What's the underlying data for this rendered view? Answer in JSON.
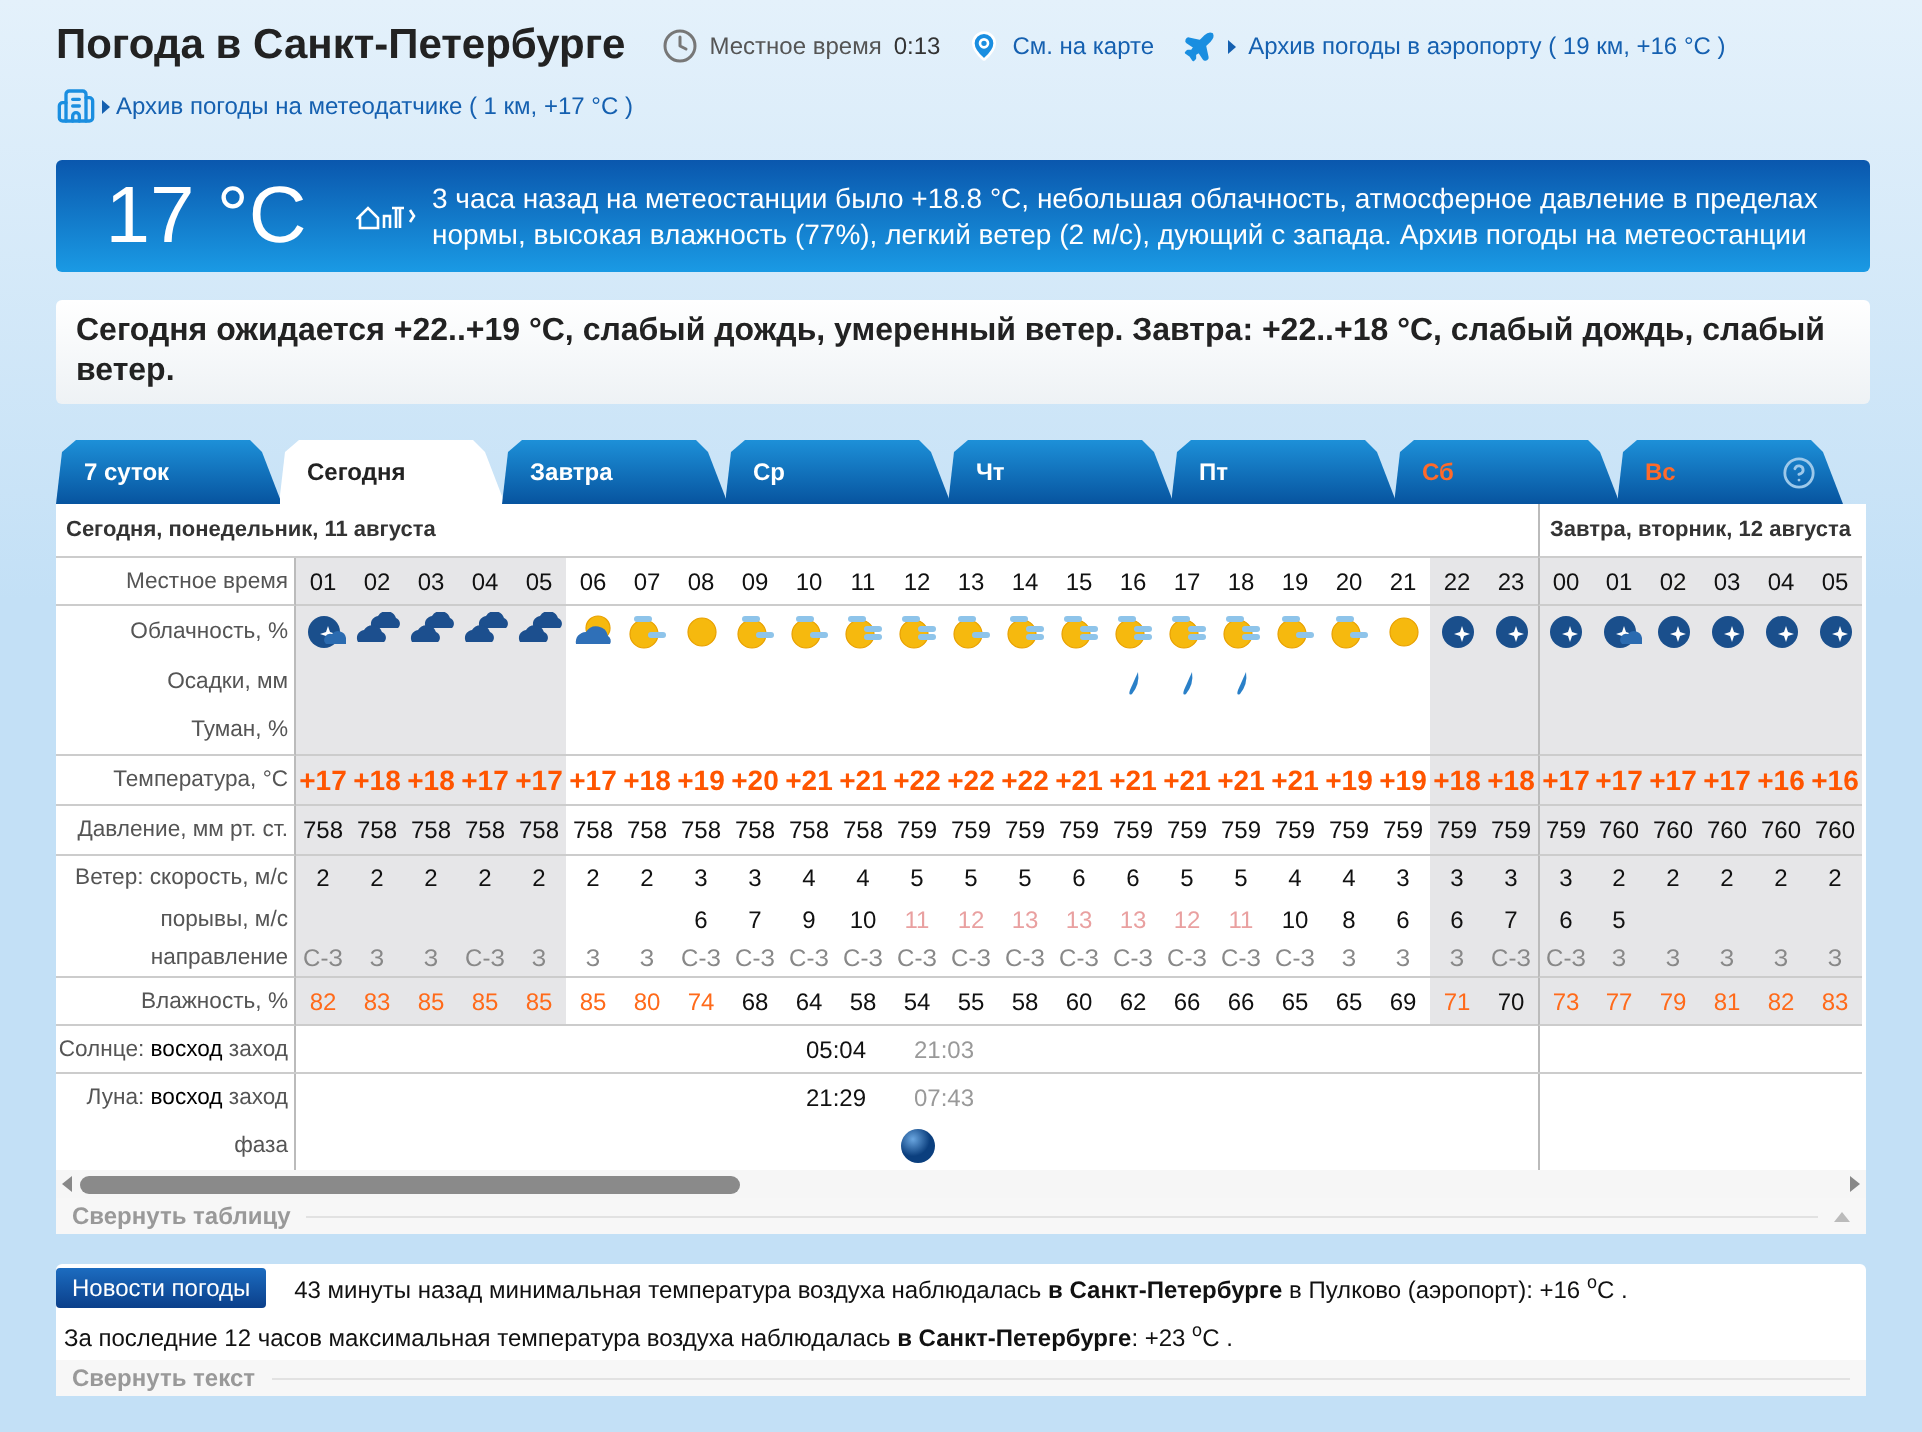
{
  "header": {
    "title": "Погода в Санкт-Петербурге",
    "time_label": "Местное время",
    "time": "0:13",
    "map_link": "См. на карте",
    "airport_link": "Архив погоды в аэропорту ( 19 км, +16 °C )",
    "sensor_link": "Архив погоды на метеодатчике ( 1 км, +17 °C )"
  },
  "current": {
    "temp": "17 °C",
    "text": "3 часа назад на метеостанции было +18.8 °C, небольшая облачность, атмосферное давление в пределах нормы, высокая влажность (77%), легкий ветер (2 м/с), дующий с запада. Архив погоды на метеостанции"
  },
  "forecast": "Сегодня ожидается +22..+19 °C, слабый дождь, умеренный ветер. Завтра: +22..+18 °C, слабый дождь, слабый ветер.",
  "tabs": [
    {
      "label": "7 суток",
      "selected": false,
      "weekend": false
    },
    {
      "label": "Сегодня",
      "selected": true,
      "weekend": false
    },
    {
      "label": "Завтра",
      "selected": false,
      "weekend": false
    },
    {
      "label": "Ср",
      "selected": false,
      "weekend": false
    },
    {
      "label": "Чт",
      "selected": false,
      "weekend": false
    },
    {
      "label": "Пт",
      "selected": false,
      "weekend": false
    },
    {
      "label": "Сб",
      "selected": false,
      "weekend": true
    },
    {
      "label": "Вс",
      "selected": false,
      "weekend": true
    }
  ],
  "table": {
    "labels": {
      "time": "Местное время",
      "sky": "Облачность, %",
      "precip": "Осадки, мм",
      "fog": "Туман, %",
      "temp": "Температура, °C",
      "pressure": "Давление, мм рт. ст.",
      "wind": "Ветер: скорость, м/с",
      "gust": "порывы, м/с",
      "dir": "направление",
      "humidity": "Влажность, %",
      "sun": "Солнце: **восход** заход",
      "moon": "Луна: **восход** заход",
      "phase": "фаза"
    },
    "days": [
      {
        "date": "Сегодня, понедельник, 11 августа",
        "hours": [
          {
            "h": "01",
            "night": true,
            "sky": {
              "kind": "night-partly"
            },
            "rain": false,
            "temp": "+17",
            "pressure": "758",
            "wind": "2",
            "dir": "С-З",
            "humidity": {
              "value": "82",
              "high": true
            }
          },
          {
            "h": "02",
            "night": true,
            "sky": {
              "kind": "night-cloudy"
            },
            "rain": false,
            "temp": "+18",
            "pressure": "758",
            "wind": "2",
            "dir": "З",
            "humidity": {
              "value": "83",
              "high": true
            }
          },
          {
            "h": "03",
            "night": true,
            "sky": {
              "kind": "night-cloudy"
            },
            "rain": false,
            "temp": "+18",
            "pressure": "758",
            "wind": "2",
            "dir": "З",
            "humidity": {
              "value": "85",
              "high": true
            }
          },
          {
            "h": "04",
            "night": true,
            "sky": {
              "kind": "night-cloudy"
            },
            "rain": false,
            "temp": "+17",
            "pressure": "758",
            "wind": "2",
            "dir": "С-З",
            "humidity": {
              "value": "85",
              "high": true
            }
          },
          {
            "h": "05",
            "night": true,
            "sky": {
              "kind": "night-cloudy"
            },
            "rain": false,
            "temp": "+17",
            "pressure": "758",
            "wind": "2",
            "dir": "З",
            "humidity": {
              "value": "85",
              "high": true
            }
          },
          {
            "h": "06",
            "night": false,
            "sky": {
              "kind": "cloud-sun"
            },
            "rain": false,
            "temp": "+17",
            "pressure": "758",
            "wind": "2",
            "dir": "З",
            "humidity": {
              "value": "85",
              "high": true
            }
          },
          {
            "h": "07",
            "night": false,
            "sky": {
              "kind": "sun-cloud"
            },
            "rain": false,
            "temp": "+18",
            "pressure": "758",
            "wind": "2",
            "dir": "З",
            "humidity": {
              "value": "80",
              "high": true
            }
          },
          {
            "h": "08",
            "night": false,
            "sky": {
              "kind": "sun"
            },
            "rain": false,
            "temp": "+19",
            "pressure": "758",
            "wind": "3",
            "gust": {
              "value": "6",
              "faded": false
            },
            "dir": "С-З",
            "humidity": {
              "value": "74",
              "high": true
            }
          },
          {
            "h": "09",
            "night": false,
            "sky": {
              "kind": "sun-cloud"
            },
            "rain": false,
            "temp": "+20",
            "pressure": "758",
            "wind": "3",
            "gust": {
              "value": "7",
              "faded": false
            },
            "dir": "С-З",
            "humidity": {
              "value": "68",
              "high": false
            }
          },
          {
            "h": "10",
            "night": false,
            "sky": {
              "kind": "sun-cloud"
            },
            "rain": false,
            "temp": "+21",
            "pressure": "758",
            "wind": "4",
            "gust": {
              "value": "9",
              "faded": false
            },
            "dir": "С-З",
            "humidity": {
              "value": "64",
              "high": false
            }
          },
          {
            "h": "11",
            "night": false,
            "sky": {
              "kind": "sun-clouds"
            },
            "rain": false,
            "temp": "+21",
            "pressure": "758",
            "wind": "4",
            "gust": {
              "value": "10",
              "faded": false
            },
            "dir": "С-З",
            "humidity": {
              "value": "58",
              "high": false
            }
          },
          {
            "h": "12",
            "night": false,
            "sky": {
              "kind": "sun-clouds"
            },
            "rain": false,
            "temp": "+22",
            "pressure": "759",
            "wind": "5",
            "gust": {
              "value": "11",
              "faded": true
            },
            "dir": "С-З",
            "humidity": {
              "value": "54",
              "high": false
            }
          },
          {
            "h": "13",
            "night": false,
            "sky": {
              "kind": "sun-cloud"
            },
            "rain": false,
            "temp": "+22",
            "pressure": "759",
            "wind": "5",
            "gust": {
              "value": "12",
              "faded": true
            },
            "dir": "С-З",
            "humidity": {
              "value": "55",
              "high": false
            }
          },
          {
            "h": "14",
            "night": false,
            "sky": {
              "kind": "sun-clouds"
            },
            "rain": false,
            "temp": "+22",
            "pressure": "759",
            "wind": "5",
            "gust": {
              "value": "13",
              "faded": true
            },
            "dir": "С-З",
            "humidity": {
              "value": "58",
              "high": false
            }
          },
          {
            "h": "15",
            "night": false,
            "sky": {
              "kind": "sun-clouds"
            },
            "rain": false,
            "temp": "+21",
            "pressure": "759",
            "wind": "6",
            "gust": {
              "value": "13",
              "faded": true
            },
            "dir": "С-З",
            "humidity": {
              "value": "60",
              "high": false
            }
          },
          {
            "h": "16",
            "night": false,
            "sky": {
              "kind": "sun-clouds"
            },
            "rain": true,
            "temp": "+21",
            "pressure": "759",
            "wind": "6",
            "gust": {
              "value": "13",
              "faded": true
            },
            "dir": "С-З",
            "humidity": {
              "value": "62",
              "high": false
            }
          },
          {
            "h": "17",
            "night": false,
            "sky": {
              "kind": "sun-clouds"
            },
            "rain": true,
            "temp": "+21",
            "pressure": "759",
            "wind": "5",
            "gust": {
              "value": "12",
              "faded": true
            },
            "dir": "С-З",
            "humidity": {
              "value": "66",
              "high": false
            }
          },
          {
            "h": "18",
            "night": false,
            "sky": {
              "kind": "sun-clouds"
            },
            "rain": true,
            "temp": "+21",
            "pressure": "759",
            "wind": "5",
            "gust": {
              "value": "11",
              "faded": true
            },
            "dir": "С-З",
            "humidity": {
              "value": "66",
              "high": false
            }
          },
          {
            "h": "19",
            "night": false,
            "sky": {
              "kind": "sun-cloud"
            },
            "rain": false,
            "temp": "+21",
            "pressure": "759",
            "wind": "4",
            "gust": {
              "value": "10",
              "faded": false
            },
            "dir": "С-З",
            "humidity": {
              "value": "65",
              "high": false
            }
          },
          {
            "h": "20",
            "night": false,
            "sky": {
              "kind": "sun-cloud"
            },
            "rain": false,
            "temp": "+19",
            "pressure": "759",
            "wind": "4",
            "gust": {
              "value": "8",
              "faded": false
            },
            "dir": "З",
            "humidity": {
              "value": "65",
              "high": false
            }
          },
          {
            "h": "21",
            "night": false,
            "sky": {
              "kind": "sun"
            },
            "rain": false,
            "temp": "+19",
            "pressure": "759",
            "wind": "3",
            "gust": {
              "value": "6",
              "faded": false
            },
            "dir": "З",
            "humidity": {
              "value": "69",
              "high": false
            }
          },
          {
            "h": "22",
            "night": true,
            "sky": {
              "kind": "night-clear"
            },
            "rain": false,
            "temp": "+18",
            "pressure": "759",
            "wind": "3",
            "gust": {
              "value": "6",
              "faded": false
            },
            "dir": "З",
            "humidity": {
              "value": "71",
              "high": true
            }
          },
          {
            "h": "23",
            "night": true,
            "sky": {
              "kind": "night-clear"
            },
            "rain": false,
            "temp": "+18",
            "pressure": "759",
            "wind": "3",
            "gust": {
              "value": "7",
              "faded": false
            },
            "dir": "С-З",
            "humidity": {
              "value": "70",
              "high": false
            }
          }
        ]
      },
      {
        "date": "Завтра, вторник, 12 августа",
        "hours": [
          {
            "h": "00",
            "night": true,
            "sky": {
              "kind": "night-clear"
            },
            "rain": false,
            "temp": "+17",
            "pressure": "759",
            "wind": "3",
            "gust": {
              "value": "6",
              "faded": false
            },
            "dir": "С-З",
            "humidity": {
              "value": "73",
              "high": true
            }
          },
          {
            "h": "01",
            "night": true,
            "sky": {
              "kind": "night-partly"
            },
            "rain": false,
            "temp": "+17",
            "pressure": "760",
            "wind": "2",
            "gust": {
              "value": "5",
              "faded": false
            },
            "dir": "З",
            "humidity": {
              "value": "77",
              "high": true
            }
          },
          {
            "h": "02",
            "night": true,
            "sky": {
              "kind": "night-clear"
            },
            "rain": false,
            "temp": "+17",
            "pressure": "760",
            "wind": "2",
            "dir": "З",
            "humidity": {
              "value": "79",
              "high": true
            }
          },
          {
            "h": "03",
            "night": true,
            "sky": {
              "kind": "night-clear"
            },
            "rain": false,
            "temp": "+17",
            "pressure": "760",
            "wind": "2",
            "dir": "З",
            "humidity": {
              "value": "81",
              "high": true
            }
          },
          {
            "h": "04",
            "night": true,
            "sky": {
              "kind": "night-clear"
            },
            "rain": false,
            "temp": "+16",
            "pressure": "760",
            "wind": "2",
            "dir": "З",
            "humidity": {
              "value": "82",
              "high": true
            }
          },
          {
            "h": "05",
            "night": true,
            "sky": {
              "kind": "night-clear"
            },
            "rain": false,
            "temp": "+16",
            "pressure": "760",
            "wind": "2",
            "dir": "З",
            "humidity": {
              "value": "83",
              "high": true
            }
          }
        ]
      }
    ],
    "sun": {
      "rise": "05:04",
      "set": "21:03"
    },
    "moon": {
      "rise": "21:29",
      "set": "07:43"
    },
    "collapse": "Свернуть таблицу"
  },
  "news": {
    "badge": "Новости погоды",
    "items": [
      "43 минуты назад минимальная температура воздуха наблюдалась **в Санкт-Петербурге** в Пулково (аэропорт): +16 $^{o}$C .",
      "За последние 12 часов максимальная температура воздуха наблюдалась **в Санкт-Петербурге**: +23 $^{o}$C ."
    ],
    "collapse": "Свернуть текст"
  }
}
